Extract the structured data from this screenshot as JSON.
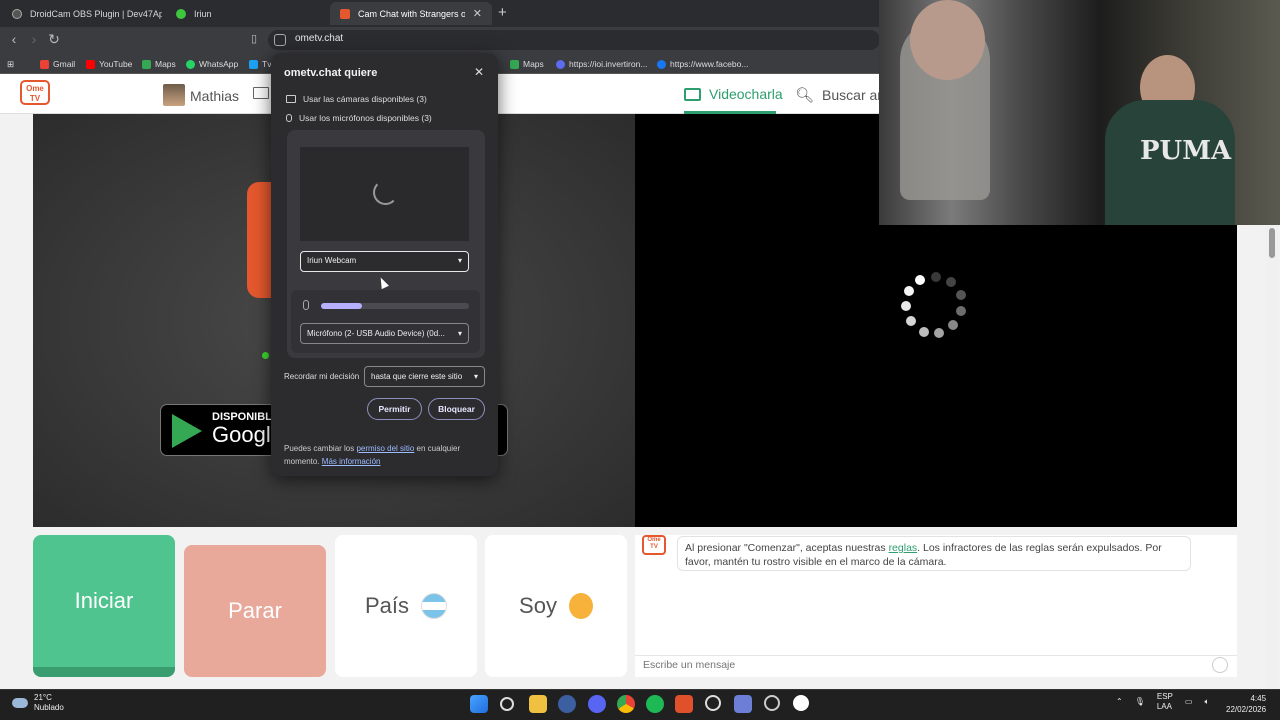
{
  "browser": {
    "tabs": [
      {
        "label": "DroidCam OBS Plugin | Dev47Apps",
        "active": false
      },
      {
        "label": "Iriun",
        "active": false
      },
      {
        "label": "Cam Chat with Strangers on Ome",
        "active": true
      }
    ],
    "url": "ometv.chat",
    "bookmarks": [
      "Gmail",
      "YouTube",
      "Maps",
      "WhatsApp",
      "Tv",
      "Maps",
      "https://ioi.invertiron...",
      "https://www.facebo..."
    ]
  },
  "site": {
    "logo_text": "Ome TV",
    "username": "Mathias",
    "video_tab": "Videocharla",
    "search_tab": "Buscar ami",
    "gplay_small": "DISPONIBLE",
    "gplay_big": "Google"
  },
  "dialog": {
    "title": "ometv.chat quiere",
    "perm_cameras": "Usar las cámaras disponibles (3)",
    "perm_mics": "Usar los micrófonos disponibles (3)",
    "camera_select": "Iriun Webcam",
    "mic_select": "Micrófono (2- USB Audio Device) (0d...",
    "mic_level": 0.28,
    "remember_label": "Recordar mi decisión",
    "remember_select": "hasta que cierre este sitio",
    "allow": "Permitir",
    "block": "Bloquear",
    "footer_pre": "Puedes cambiar los ",
    "footer_link": "permiso del sitio",
    "footer_mid": " en cualquier momento. ",
    "footer_more": "Más información"
  },
  "controls": {
    "start": "Iniciar",
    "stop": "Parar",
    "country": "País",
    "gender": "Soy"
  },
  "chat": {
    "msg_pre": "Al presionar \"Comenzar\", aceptas nuestras ",
    "msg_link": "reglas",
    "msg_post": ". Los infractores de las reglas serán expulsados. Por favor, mantén tu rostro visible en el marco de la cámara.",
    "placeholder": "Escribe un mensaje"
  },
  "webcam": {
    "shirt_text": "PUMA"
  },
  "taskbar": {
    "temp": "21°C",
    "weather": "Nublado",
    "lang1": "ESP",
    "lang2": "LAA",
    "time": "4:45",
    "date": "22/02/2026"
  },
  "colors": {
    "accent_green": "#2e9e6e",
    "start_button": "#4fc48e",
    "stop_button": "#e8a89a",
    "brand_orange": "#e5582e"
  }
}
